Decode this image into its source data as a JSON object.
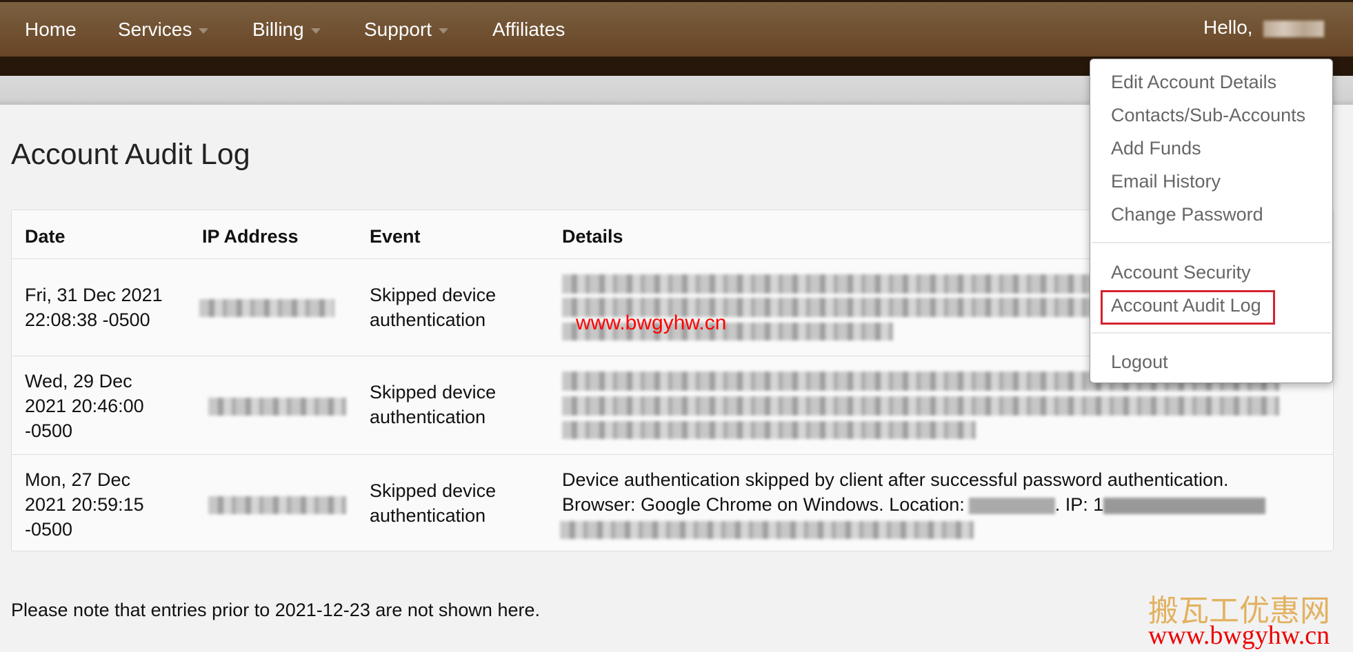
{
  "nav": {
    "items": [
      {
        "label": "Home",
        "dropdown": false
      },
      {
        "label": "Services",
        "dropdown": true
      },
      {
        "label": "Billing",
        "dropdown": true
      },
      {
        "label": "Support",
        "dropdown": true
      },
      {
        "label": "Affiliates",
        "dropdown": false
      }
    ],
    "hello": "Hello,"
  },
  "page": {
    "title": "Account Audit Log",
    "note": "Please note that entries prior to 2021-12-23 are not shown here."
  },
  "table": {
    "headers": [
      "Date",
      "IP Address",
      "Event",
      "Details"
    ],
    "rows": [
      {
        "date": "Fri, 31 Dec 2021 22:08:38 -0500",
        "event": "Skipped device authentication",
        "details": ""
      },
      {
        "date": "Wed, 29 Dec 2021 20:46:00 -0500",
        "event": "Skipped device authentication",
        "details": ""
      },
      {
        "date": "Mon, 27 Dec 2021 20:59:15 -0500",
        "event": "Skipped device authentication",
        "details_line1": "Device authentication skipped by client after successful password authentication.",
        "details_line2a": "Browser: Google Chrome on Windows. Location:",
        "details_line2b": ". IP: 1"
      }
    ]
  },
  "menu": {
    "items": [
      "Edit Account Details",
      "Contacts/Sub-Accounts",
      "Add Funds",
      "Email History",
      "Change Password",
      "Account Security",
      "Account Audit Log",
      "Logout"
    ],
    "highlighted": "Account Audit Log"
  },
  "watermarks": {
    "inline": "www.bwgyhw.cn",
    "brand": "搬瓦工优惠网",
    "url": "www.bwgyhw.cn"
  },
  "colors": {
    "nav": "#6e4c2c",
    "highlight": "#d3222e"
  }
}
